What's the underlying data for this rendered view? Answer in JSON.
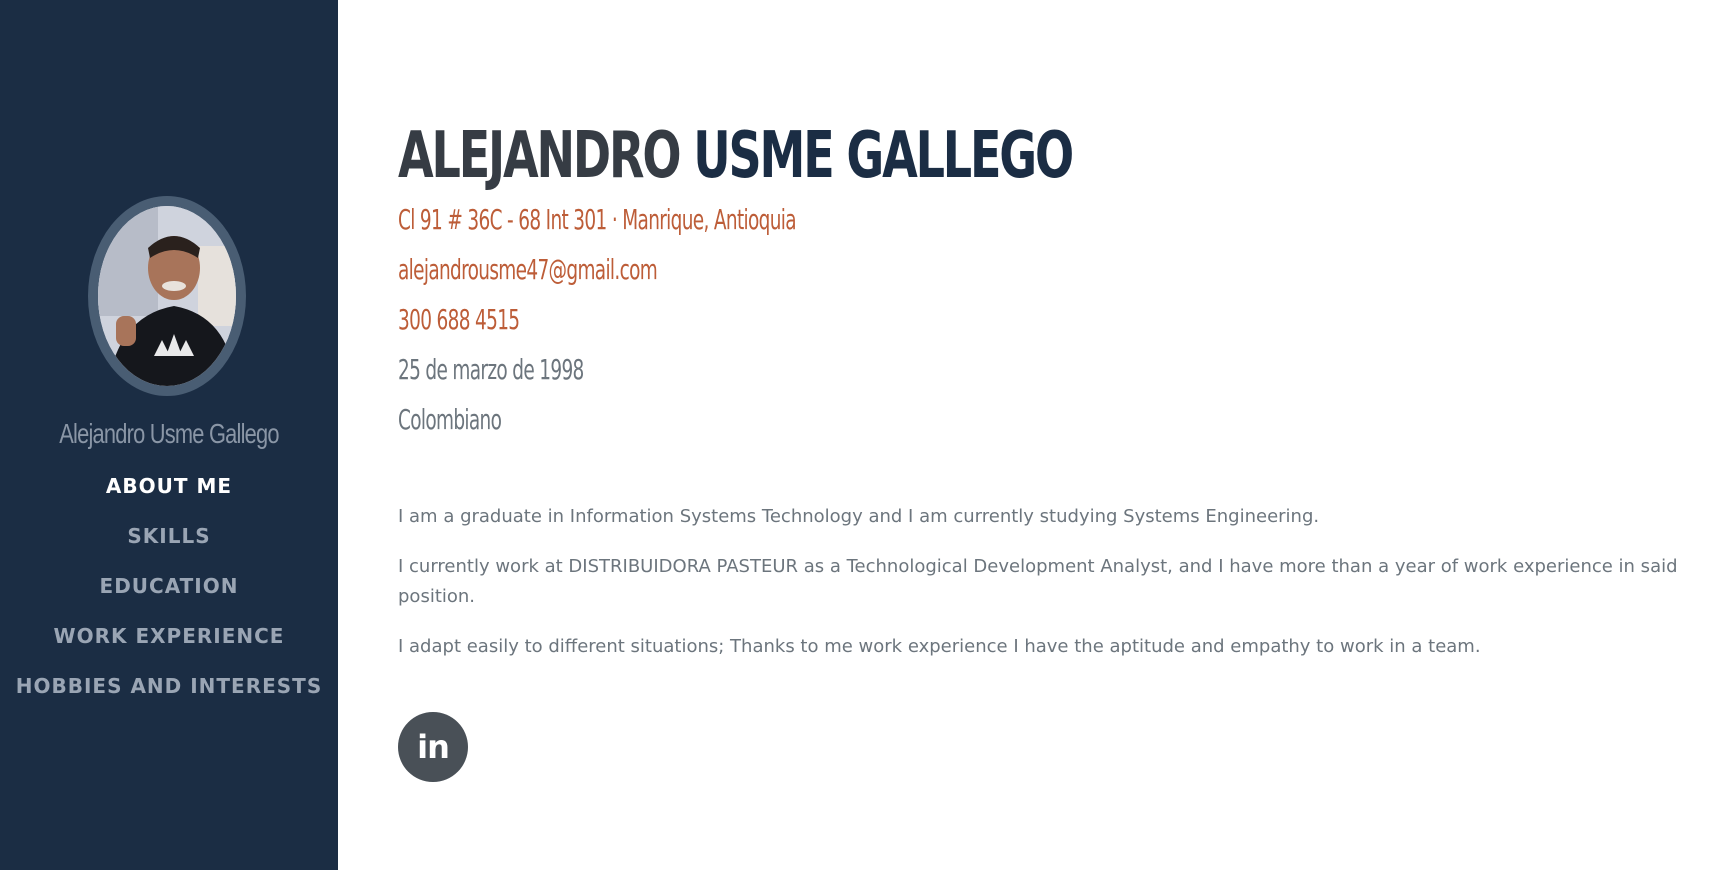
{
  "sidebar": {
    "name": "Alejandro Usme Gallego",
    "nav": [
      {
        "label": "ABOUT ME",
        "active": true
      },
      {
        "label": "SKILLS",
        "active": false
      },
      {
        "label": "EDUCATION",
        "active": false
      },
      {
        "label": "WORK EXPERIENCE",
        "active": false
      },
      {
        "label": "HOBBIES AND INTERESTS",
        "active": false
      }
    ]
  },
  "main": {
    "first_name": "ALEJANDRO",
    "last_name": "USME GALLEGO",
    "address": "Cl 91 # 36C - 68 Int 301 · Manrique, Antioquia",
    "email": "alejandrousme47@gmail.com",
    "phone": "300 688 4515",
    "birthdate": "25 de marzo de 1998",
    "nationality": "Colombiano",
    "paragraphs": [
      "I am a graduate in Information Systems Technology and I am currently studying Systems Engineering.",
      "I currently work at DISTRIBUIDORA PASTEUR as a Technological Development Analyst, and I have more than a year of work experience in said position.",
      "I adapt easily to different situations; Thanks to me work experience I have the aptitude and empathy to work in a team."
    ],
    "social": {
      "icon": "linkedin-icon",
      "label": "in"
    }
  },
  "colors": {
    "sidebar_bg": "#1b2d44",
    "accent": "#bd5d38",
    "muted_text": "#6c757d",
    "social_bg": "#495057"
  }
}
